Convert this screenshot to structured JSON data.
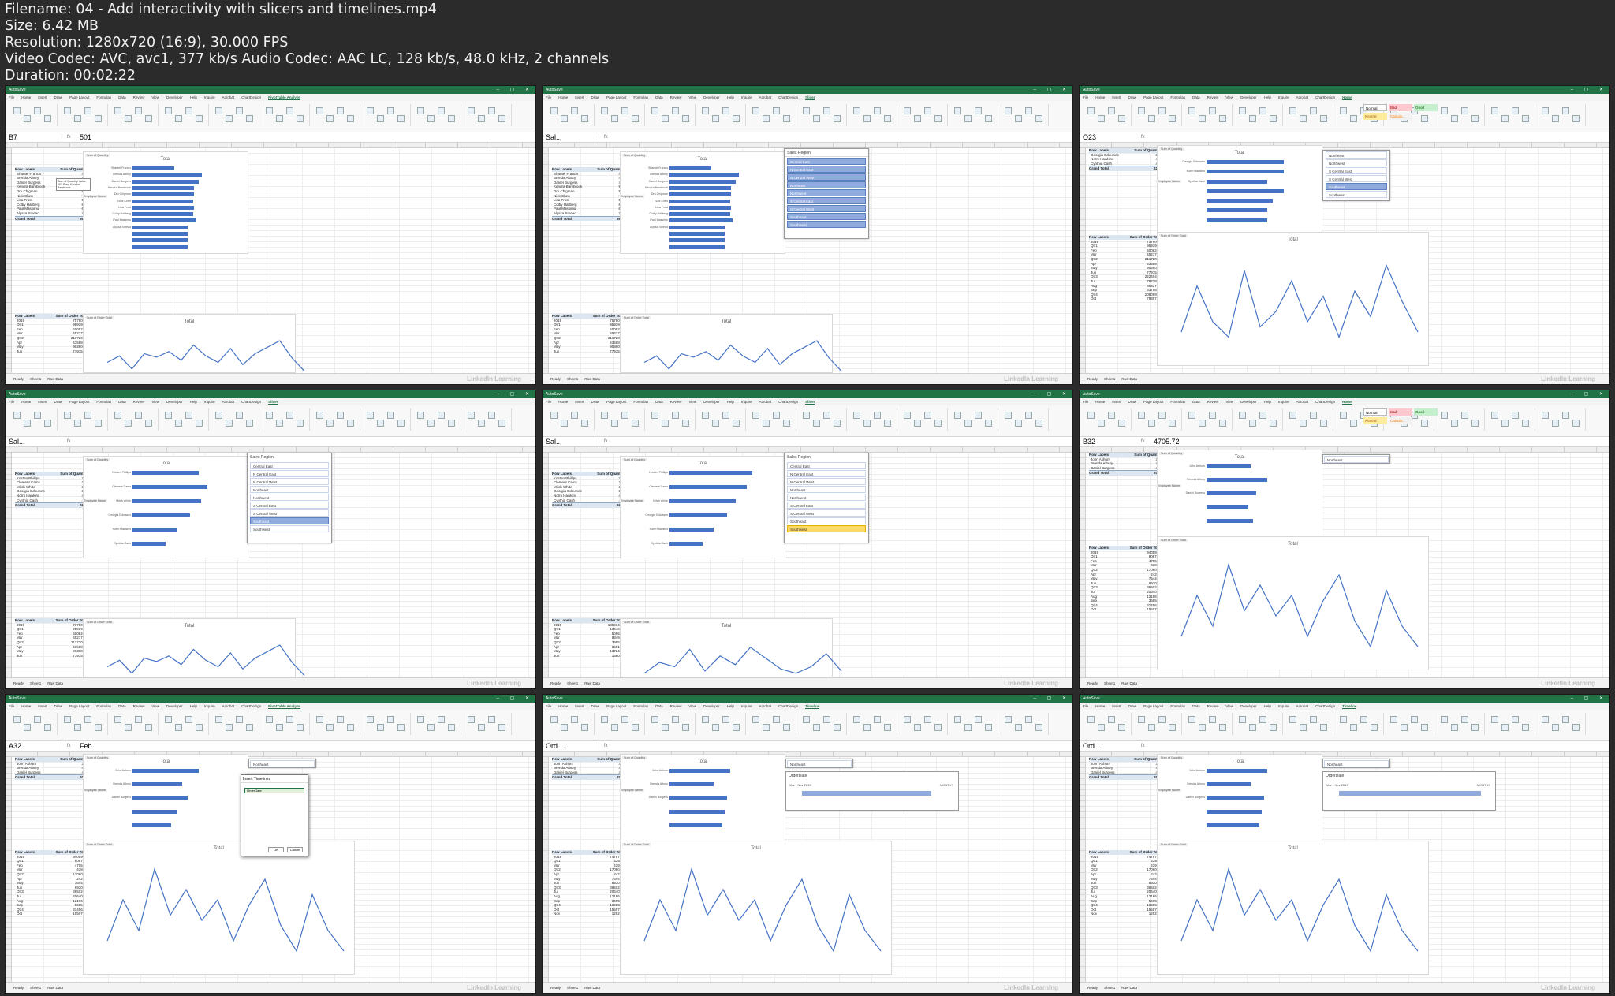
{
  "header": {
    "lines": [
      "Filename: 04 - Add interactivity with slicers and timelines.mp4",
      "Size: 6.42 MB",
      "Resolution: 1280x720 (16:9), 30.000 FPS",
      "Video Codec: AVC, avc1, 377 kb/s Audio Codec: AAC LC, 128 kb/s, 48.0 kHz, 2 channels",
      "Duration: 00:02:22"
    ]
  },
  "common": {
    "app_title": "AutoSave",
    "tabs_file": "File",
    "tabs_home": "Home",
    "tabs_insert": "Insert",
    "tabs_draw": "Draw",
    "tabs_layout": "Page Layout",
    "tabs_formulas": "Formulas",
    "tabs_data": "Data",
    "tabs_review": "Review",
    "tabs_view": "View",
    "tabs_developer": "Developer",
    "tabs_help": "Help",
    "tabs_inquire": "Inquire",
    "tabs_acrobat": "Acrobat",
    "tabs_chart": "ChartDesign",
    "share": "Share",
    "comments": "Comments",
    "sheet1": "Sheet1",
    "sheet2": "Raw Data",
    "ready": "Ready",
    "watermark": "LinkedIn Learning",
    "fx": "fx",
    "sum_qty": "Sum of Quantity",
    "sum_order": "Sum of Order Total",
    "total": "Total",
    "row_labels": "Row Labels",
    "grand_total": "Grand Total",
    "employee_name": "Employee Name",
    "slicer_title": "Sales Region",
    "timeline_title": "OrderDate",
    "timeline_range": "Mar - Nov 2019",
    "timeline_months": "MONTHS",
    "dialog_title": "Insert Timelines",
    "dialog_ok": "OK",
    "dialog_cancel": "Cancel",
    "dialog_item": "OrderDate",
    "style_normal": "Normal",
    "style_bad": "Bad",
    "style_good": "Good",
    "style_neutral": "Neutral",
    "style_calc": "Calcula..."
  },
  "regions": [
    "Central East",
    "N Central East",
    "N Central West",
    "Northeast",
    "Northwest",
    "S Central East",
    "S Central West",
    "Southeast",
    "Southwest"
  ],
  "tiles": [
    {
      "name_box": "B7",
      "formula": "501",
      "active_tab": "PivotTable Analyze",
      "pivot1": {
        "rows": [
          [
            "Shantel Francis",
            "475"
          ],
          [
            "Brenda Albury",
            "493"
          ],
          [
            "Daniel Burgess",
            "497"
          ],
          [
            "Kendra Bambrook",
            "501"
          ],
          [
            "Dru Chigman",
            "513"
          ],
          [
            "Nick Chen",
            "594"
          ],
          [
            "Lisa Frost",
            "584"
          ],
          [
            "Colby Hallberg",
            "636"
          ],
          [
            "Paul Massimo",
            "656"
          ],
          [
            "Alyssa Smead",
            "720"
          ]
        ],
        "total": "5680"
      },
      "pivot2": {
        "rows": [
          [
            "2019",
            "757903.6"
          ],
          [
            "Qtr1",
            "95939.58"
          ],
          [
            "Feb",
            "50082.57"
          ],
          [
            "Mar",
            "45277.01"
          ],
          [
            "Qtr2",
            "211720.29"
          ],
          [
            "Apr",
            "43588.29"
          ],
          [
            "May",
            "90360.56"
          ],
          [
            "Jun",
            "77975.38"
          ]
        ]
      },
      "tooltip": "Sum of Quantity Value: 501 Row: Kendra Bambrook"
    },
    {
      "name_box": "Sal...",
      "formula": "",
      "active_tab": "Slicer",
      "pivot1": {
        "rows": [
          [
            "Shantel Francis",
            "475"
          ],
          [
            "Brenda Albury",
            "493"
          ],
          [
            "Daniel Burgess",
            "497"
          ],
          [
            "Kendra Bambrook",
            "501"
          ],
          [
            "Dru Chigman",
            "513"
          ],
          [
            "Nick Chen",
            "594"
          ],
          [
            "Lisa Frost",
            "584"
          ],
          [
            "Colby Hallberg",
            "636"
          ],
          [
            "Paul Massimo",
            "656"
          ],
          [
            "Alyssa Smead",
            "720"
          ]
        ],
        "total": "5680"
      },
      "pivot2": {
        "rows": [
          [
            "2019",
            "757903.6"
          ],
          [
            "Qtr1",
            "95939.58"
          ],
          [
            "Feb",
            "50082.57"
          ],
          [
            "Mar",
            "45277.01"
          ],
          [
            "Qtr2",
            "211720.29"
          ],
          [
            "Apr",
            "43588.29"
          ],
          [
            "May",
            "90360.56"
          ],
          [
            "Jun",
            "77975.38"
          ]
        ]
      }
    },
    {
      "name_box": "O23",
      "formula": "",
      "active_tab": "Home",
      "pivot1": {
        "rows": [
          [
            "Georgia Edouwes",
            "399"
          ],
          [
            "Norm Hawkins",
            "440"
          ],
          [
            "Cynthia Cash",
            "469"
          ]
        ],
        "total": "2244"
      },
      "pivot2": {
        "rows": [
          [
            "2019",
            "737903.6"
          ],
          [
            "Qtr1",
            "95939.58"
          ],
          [
            "Feb",
            "50082.57"
          ],
          [
            "Mar",
            "45277.01"
          ],
          [
            "Qtr2",
            "211720.29"
          ],
          [
            "Apr",
            "43588.29"
          ],
          [
            "May",
            "90360.56"
          ],
          [
            "Jun",
            "77975.38"
          ],
          [
            "Qtr3",
            "222404.76"
          ],
          [
            "Jul",
            "78238.22"
          ],
          [
            "Aug",
            "80427.72"
          ],
          [
            "Sep",
            "63758.82"
          ],
          [
            "Qtr4",
            "208099.03"
          ],
          [
            "Oct",
            "79357.85"
          ]
        ]
      }
    },
    {
      "name_box": "Sal...",
      "formula": "",
      "active_tab": "Slicer",
      "pivot1": {
        "rows": [
          [
            "Kristen Phillips",
            "259"
          ],
          [
            "Clement Cams",
            "290"
          ],
          [
            "Mitch White",
            "387"
          ],
          [
            "Georgia Edouwes",
            "399"
          ],
          [
            "Norm Hawkins",
            "440"
          ],
          [
            "Cynthia Cash",
            "469"
          ]
        ],
        "total": "2244"
      },
      "pivot2": {
        "rows": [
          [
            "2019",
            "737903.6"
          ],
          [
            "Qtr1",
            "95939.58"
          ],
          [
            "Feb",
            "50082.57"
          ],
          [
            "Mar",
            "45277.01"
          ],
          [
            "Qtr2",
            "211720.29"
          ],
          [
            "Apr",
            "43588.29"
          ],
          [
            "May",
            "90360.56"
          ],
          [
            "Jun",
            "77975.38"
          ]
        ]
      }
    },
    {
      "name_box": "Sal...",
      "formula": "",
      "active_tab": "Slicer",
      "pivot1": {
        "rows": [
          [
            "Kristen Phillips",
            "259"
          ],
          [
            "Clement Cams",
            "290"
          ],
          [
            "Mitch White",
            "387"
          ],
          [
            "Georgia Edouwes",
            "399"
          ],
          [
            "Norm Hawkins",
            "440"
          ],
          [
            "Cynthia Cash",
            "469"
          ]
        ],
        "total": "2244"
      },
      "pivot2": {
        "rows": [
          [
            "2019",
            "135974.41"
          ],
          [
            "Qtr1",
            "13446.29"
          ],
          [
            "Feb",
            "5096.84"
          ],
          [
            "Mar",
            "8349.45"
          ],
          [
            "Qtr2",
            "39559.7"
          ],
          [
            "Apr",
            "8501.33"
          ],
          [
            "May",
            "13724.87"
          ],
          [
            "Jun",
            "13604.5"
          ]
        ]
      }
    },
    {
      "name_box": "B32",
      "formula": "4705.72",
      "active_tab": "Home",
      "pivot1": {
        "rows": [
          [
            "John Ashurn",
            "399"
          ],
          [
            "Brenda Albury",
            "493"
          ],
          [
            "Daniel Burgess",
            "457"
          ]
        ],
        "total": "2007"
      },
      "pivot2": {
        "rows": [
          [
            "2019",
            "94059.87"
          ],
          [
            "Qtr1",
            "9087.32"
          ],
          [
            "Feb",
            "4705.72"
          ],
          [
            "Mar",
            "4381.6"
          ],
          [
            "Qtr2",
            "17060.01"
          ],
          [
            "Apr",
            "2428.2"
          ],
          [
            "May",
            "7644.74"
          ],
          [
            "Jun",
            "6930.07"
          ],
          [
            "Qtr3",
            "36502.56"
          ],
          [
            "Jul",
            "20640.15"
          ],
          [
            "Aug",
            "12166.98"
          ],
          [
            "Sep",
            "3695.43"
          ],
          [
            "Qtr4",
            "31456.98"
          ],
          [
            "Oct",
            "15507.15"
          ]
        ]
      }
    },
    {
      "name_box": "A32",
      "formula": "Feb",
      "active_tab": "PivotTable Analyze",
      "pivot1": {
        "rows": [
          [
            "John Ashurn",
            "399"
          ],
          [
            "Brenda Albury",
            "493"
          ],
          [
            "Daniel Burgess",
            "457"
          ]
        ],
        "total": "2007"
      },
      "pivot2": {
        "rows": [
          [
            "2019",
            "94059.87"
          ],
          [
            "Qtr1",
            "9087.32"
          ],
          [
            "Feb",
            "4705.72"
          ],
          [
            "Mar",
            "4381.6"
          ],
          [
            "Qtr2",
            "17060.01"
          ],
          [
            "Apr",
            "2428.2"
          ],
          [
            "May",
            "7644.74"
          ],
          [
            "Jun",
            "6930.07"
          ],
          [
            "Qtr3",
            "36502.56"
          ],
          [
            "Jul",
            "20640.15"
          ],
          [
            "Aug",
            "12166.98"
          ],
          [
            "Sep",
            "5695.43"
          ],
          [
            "Qtr4",
            "31456.98"
          ],
          [
            "Oct",
            "15507.15"
          ]
        ]
      }
    },
    {
      "name_box": "Ord...",
      "formula": "",
      "active_tab": "Timeline",
      "pivot1": {
        "rows": [
          [
            "John Ashurn",
            "399"
          ],
          [
            "Brenda Albury",
            "493"
          ],
          [
            "Daniel Burgess",
            "457"
          ]
        ],
        "total": "2007"
      },
      "pivot2": {
        "rows": [
          [
            "2019",
            "74797.29"
          ],
          [
            "Qtr1",
            "4391.6"
          ],
          [
            "Mar",
            "4391.6"
          ],
          [
            "Qtr2",
            "17060.01"
          ],
          [
            "Apr",
            "2428.2"
          ],
          [
            "May",
            "7644.74"
          ],
          [
            "Jun",
            "6930.07"
          ],
          [
            "Qtr3",
            "36502.56"
          ],
          [
            "Jul",
            "20640.15"
          ],
          [
            "Aug",
            "12166.98"
          ],
          [
            "Sep",
            "3695.43"
          ],
          [
            "Qtr4",
            "16999.12"
          ],
          [
            "Oct",
            "15507.15"
          ],
          [
            "Nov",
            "1292.81"
          ]
        ]
      }
    },
    {
      "name_box": "Ord...",
      "formula": "",
      "active_tab": "Timeline",
      "pivot1": {
        "rows": [
          [
            "John Ashurn",
            "399"
          ],
          [
            "Brenda Albury",
            "493"
          ],
          [
            "Daniel Burgess",
            "457"
          ]
        ],
        "total": "2007"
      },
      "pivot2": {
        "rows": [
          [
            "2019",
            "74797.29"
          ],
          [
            "Qtr1",
            "4391.6"
          ],
          [
            "Mar",
            "4391.6"
          ],
          [
            "Qtr2",
            "17060.01"
          ],
          [
            "Apr",
            "2428.2"
          ],
          [
            "May",
            "7644.74"
          ],
          [
            "Jun",
            "6930.07"
          ],
          [
            "Qtr3",
            "36502.56"
          ],
          [
            "Jul",
            "20640.15"
          ],
          [
            "Aug",
            "12166.98"
          ],
          [
            "Sep",
            "5695.43"
          ],
          [
            "Qtr4",
            "16999.12"
          ],
          [
            "Oct",
            "15507.15"
          ],
          [
            "Nov",
            "1292.81"
          ]
        ]
      }
    }
  ]
}
